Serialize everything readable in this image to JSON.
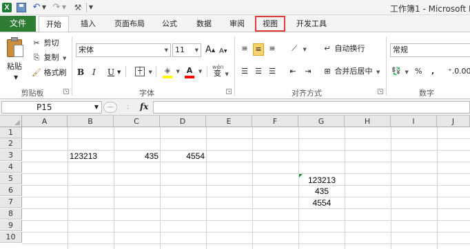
{
  "window": {
    "title": "工作簿1 - Microsoft E"
  },
  "quick_access": {
    "icons": [
      "excel-logo-icon",
      "save-icon",
      "undo-icon",
      "redo-icon",
      "customize-icon"
    ],
    "logo_glyph": "X"
  },
  "tabs": {
    "file": "文件",
    "items": [
      "开始",
      "插入",
      "页面布局",
      "公式",
      "数据",
      "审阅",
      "视图",
      "开发工具"
    ],
    "active": "开始",
    "highlighted": "视图"
  },
  "ribbon": {
    "clipboard": {
      "paste": "粘贴",
      "cut": "剪切",
      "copy": "复制",
      "format_painter": "格式刷",
      "group": "剪贴板"
    },
    "font": {
      "name": "宋体",
      "size": "11",
      "grow": "A",
      "shrink": "A",
      "bold": "B",
      "italic": "I",
      "underline": "U",
      "fill_color": "#ffff00",
      "font_color": "#ff0000",
      "wen": "wén",
      "wen_char": "变",
      "group": "字体"
    },
    "alignment": {
      "wrap": "自动换行",
      "merge": "合并后居中",
      "group": "对齐方式"
    },
    "number": {
      "format": "常规",
      "currency": "%",
      "comma": ",",
      "group": "数字"
    }
  },
  "formula_bar": {
    "name_box": "P15",
    "fx": "fx",
    "content": ""
  },
  "grid": {
    "columns": [
      "A",
      "B",
      "C",
      "D",
      "E",
      "F",
      "G",
      "H",
      "I",
      "J"
    ],
    "rows": [
      "1",
      "2",
      "3",
      "4",
      "5",
      "6",
      "7",
      "8",
      "9",
      "10"
    ],
    "cells": [
      {
        "ref": "B3",
        "value": "123213"
      },
      {
        "ref": "C3",
        "value": "435"
      },
      {
        "ref": "D3",
        "value": "4554"
      },
      {
        "ref": "G5",
        "value": "123213"
      },
      {
        "ref": "G6",
        "value": "435"
      },
      {
        "ref": "G7",
        "value": "4554"
      }
    ]
  }
}
